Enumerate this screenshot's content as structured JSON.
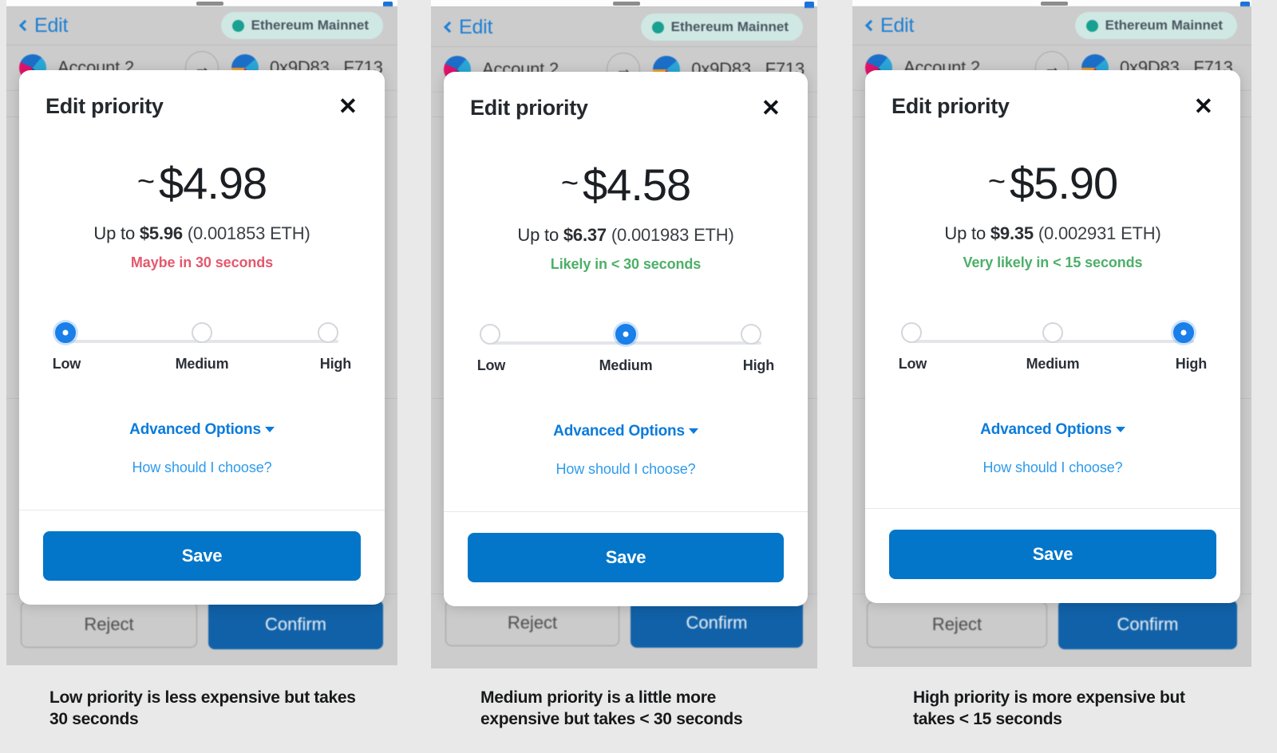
{
  "wallet": {
    "back_label": "Edit",
    "network_label": "Ethereum Mainnet",
    "account_name": "Account 2",
    "recipient": "0x9D83...F713",
    "arrow_icon": "arrow-right-icon",
    "reject_label": "Reject",
    "confirm_label": "Confirm"
  },
  "modal": {
    "title": "Edit priority",
    "close_icon": "close-icon",
    "advanced_label": "Advanced Options",
    "help_label": "How should I choose?",
    "save_label": "Save",
    "slider_labels": {
      "low": "Low",
      "medium": "Medium",
      "high": "High"
    }
  },
  "colors": {
    "accent_blue": "#0376c9",
    "link_blue": "#0a7bdc",
    "knob_blue": "#1a7fe8",
    "confirm_blue": "#1161a8",
    "danger_red": "#e4586c",
    "success_green": "#4caf68",
    "network_teal": "#18a090",
    "network_pill_bg": "#cfe8e4"
  },
  "panels": [
    {
      "id": "low",
      "amount": "$4.98",
      "tilde": "~",
      "upto_prefix": "Up to ",
      "upto_fiat": "$5.96",
      "upto_eth": " (0.001853 ETH)",
      "speed_text": "Maybe in 30 seconds",
      "speed_color": "#e4586c",
      "selected": "low",
      "caption": "Low priority is less expensive but takes 30 seconds"
    },
    {
      "id": "medium",
      "amount": "$4.58",
      "tilde": "~",
      "upto_prefix": "Up to ",
      "upto_fiat": "$6.37",
      "upto_eth": " (0.001983 ETH)",
      "speed_text": "Likely in < 30 seconds",
      "speed_color": "#4caf68",
      "selected": "medium",
      "caption": "Medium priority is a little more expensive but takes < 30 seconds"
    },
    {
      "id": "high",
      "amount": "$5.90",
      "tilde": "~",
      "upto_prefix": "Up to ",
      "upto_fiat": "$9.35",
      "upto_eth": " (0.002931 ETH)",
      "speed_text": "Very likely in < 15 seconds",
      "speed_color": "#4caf68",
      "selected": "high",
      "caption": "High priority is more expensive but takes < 15 seconds"
    }
  ]
}
